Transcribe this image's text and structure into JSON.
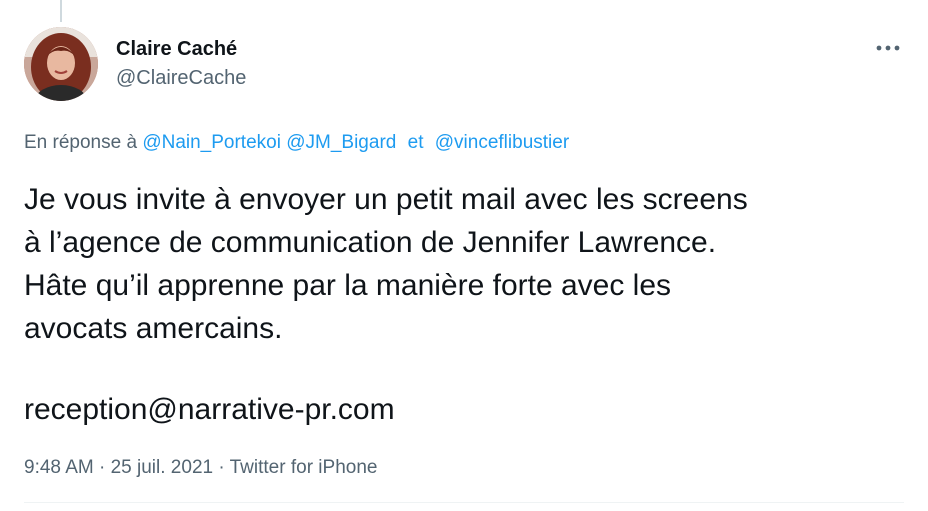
{
  "tweet": {
    "author": {
      "name": "Claire Caché",
      "handle": "@ClaireCache",
      "avatar_icon": "profile-photo"
    },
    "more_icon": "more-horizontal-icon",
    "reply_to": {
      "prefix": "En réponse à",
      "mentions": [
        "@Nain_Portekoi",
        "@JM_Bigard",
        "@vinceflibustier"
      ],
      "conjunction": "et"
    },
    "text_lines": [
      "Je vous invite à envoyer un petit mail avec les screens",
      "à l’agence de communication de Jennifer Lawrence.",
      "Hâte qu’il apprenne par la manière forte avec les",
      "avocats amercains."
    ],
    "email": "reception@narrative-pr.com",
    "meta": {
      "time": "9:48 AM",
      "dot": "·",
      "date": "25 juil. 2021",
      "source": "Twitter for iPhone"
    }
  },
  "colors": {
    "text": "#0f1419",
    "secondary": "#536471",
    "link": "#1d9bf0"
  }
}
